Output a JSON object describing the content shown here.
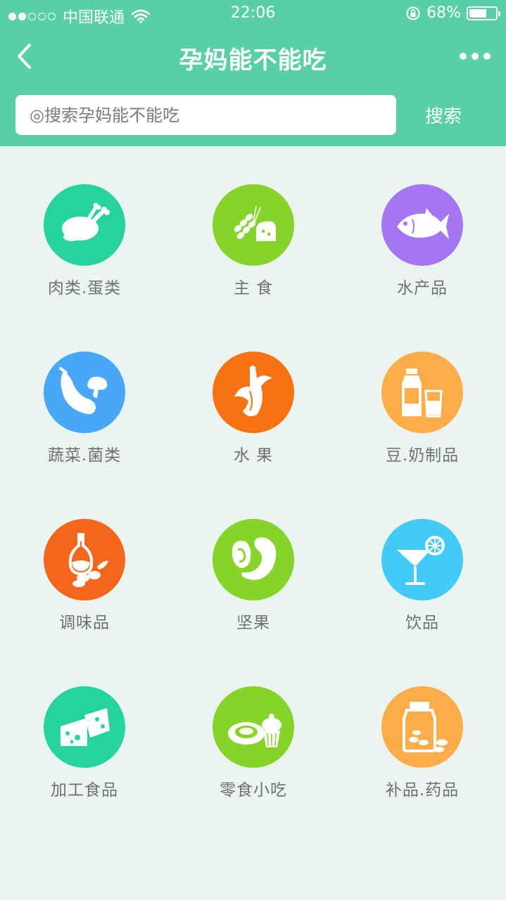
{
  "status": {
    "carrier": "中国联通",
    "time": "22:06",
    "battery": "68%",
    "battery_level": 0.68
  },
  "nav": {
    "title": "孕妈能不能吃"
  },
  "search": {
    "placeholder": "◎搜索孕妈能不能吃",
    "button": "搜索"
  },
  "categories": [
    {
      "label": "肉类.蛋类",
      "icon": "roast-chicken-icon",
      "color": "#26d39f"
    },
    {
      "label": "主 食",
      "icon": "grain-bread-icon",
      "color": "#86d32a"
    },
    {
      "label": "水产品",
      "icon": "fish-icon",
      "color": "#a576f1"
    },
    {
      "label": "蔬菜.菌类",
      "icon": "eggplant-mushroom-icon",
      "color": "#4aa7f7"
    },
    {
      "label": "水 果",
      "icon": "banana-icon",
      "color": "#f87214"
    },
    {
      "label": "豆.奶制品",
      "icon": "milk-bottle-glass-icon",
      "color": "#fcad49"
    },
    {
      "label": "调味品",
      "icon": "oil-bottle-icon",
      "color": "#f4661b"
    },
    {
      "label": "坚果",
      "icon": "nuts-icon",
      "color": "#86d32a"
    },
    {
      "label": "饮品",
      "icon": "cocktail-icon",
      "color": "#41cbf6"
    },
    {
      "label": "加工食品",
      "icon": "cheese-icon",
      "color": "#26d39f"
    },
    {
      "label": "零食小吃",
      "icon": "snack-cupcake-icon",
      "color": "#86d32a"
    },
    {
      "label": "补品.药品",
      "icon": "pill-jar-icon",
      "color": "#fcad49"
    }
  ]
}
